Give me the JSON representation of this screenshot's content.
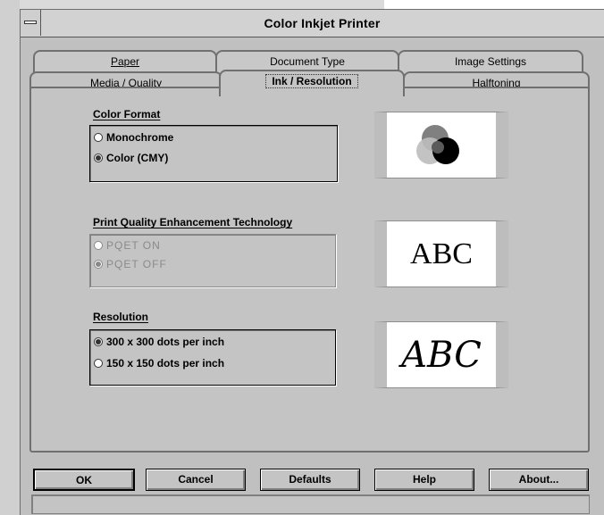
{
  "window": {
    "title": "Color Inkjet Printer"
  },
  "tabs_back": [
    {
      "label": "Paper"
    },
    {
      "label": "Document Type"
    },
    {
      "label": "Image Settings"
    }
  ],
  "tabs_front": [
    {
      "label": "Media / Quality"
    },
    {
      "label": "Ink / Resolution",
      "active": true
    },
    {
      "label": "Halftoning"
    }
  ],
  "color_format": {
    "label": "Color Format",
    "options": [
      {
        "label": "Monochrome",
        "checked": false
      },
      {
        "label": "Color (CMY)",
        "checked": true
      }
    ],
    "preview_icon": "color-circles-icon"
  },
  "pqet": {
    "label": "Print Quality Enhancement Technology",
    "enabled": false,
    "options": [
      {
        "label": "PQET ON",
        "checked": false
      },
      {
        "label": "PQET OFF",
        "checked": true
      }
    ],
    "preview_text": "ABC"
  },
  "resolution": {
    "label": "Resolution",
    "options": [
      {
        "label": "300 x 300 dots per inch",
        "checked": true
      },
      {
        "label": "150 x 150 dots per inch",
        "checked": false
      }
    ],
    "preview_text": "ABC"
  },
  "buttons": {
    "ok": "OK",
    "cancel": "Cancel",
    "defaults": "Defaults",
    "help": "Help",
    "about": "About..."
  },
  "colors": {
    "dialog_bg": "#c0c0c0",
    "cyan_circle": "#808080",
    "magenta_circle": "#bdbdbd",
    "yellow_circle": "#000000"
  }
}
